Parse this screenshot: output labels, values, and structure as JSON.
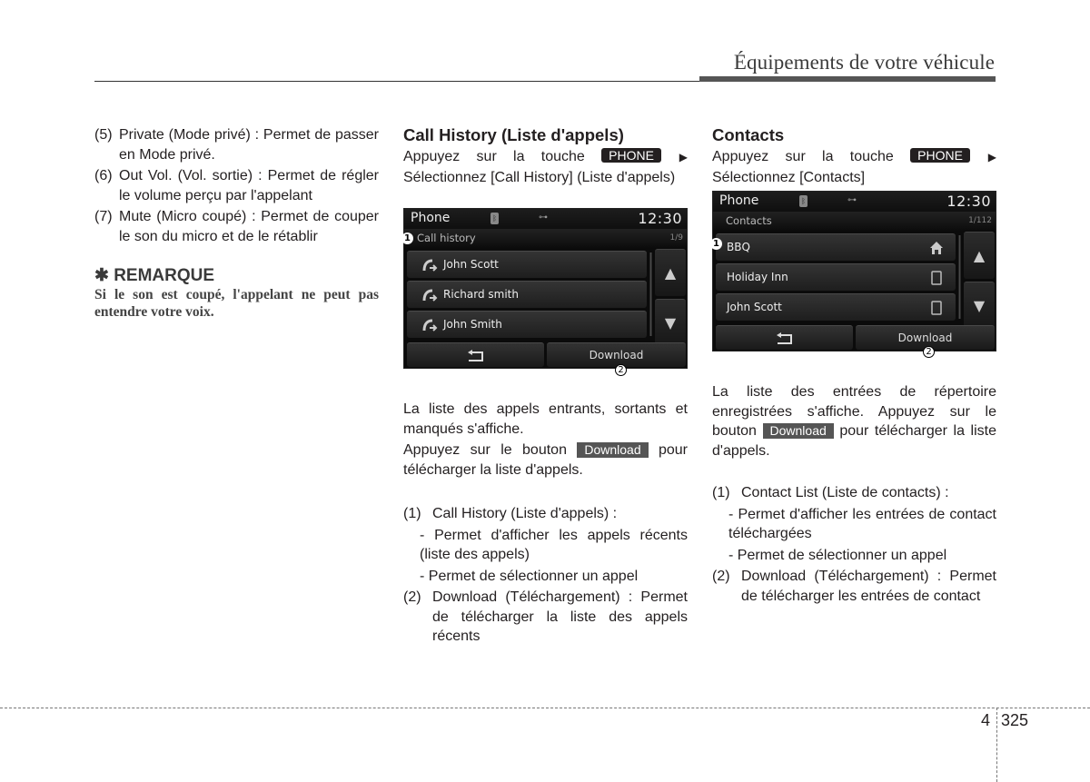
{
  "header": {
    "title": "Équipements de votre véhicule"
  },
  "col1": {
    "items": [
      {
        "num": "(5)",
        "text": "Private (Mode privé) : Permet de passer en Mode privé."
      },
      {
        "num": "(6)",
        "text": "Out Vol. (Vol. sortie) : Permet de régler le volume perçu par l'appelant"
      },
      {
        "num": "(7)",
        "text": "Mute (Micro coupé) : Permet de couper le son du micro et de le rétablir"
      }
    ],
    "note": {
      "symbol": "✱",
      "title": "REMARQUE",
      "body": "Si le son est coupé, l'appelant ne peut pas entendre votre voix."
    }
  },
  "call_history": {
    "title": "Call History (Liste d'appels)",
    "instr_pre": "Appuyez sur la touche",
    "phone_key": "PHONE",
    "instr_post": "Sélectionnez [Call History] (Liste d'appels)",
    "screen": {
      "app": "Phone",
      "time": "12:30",
      "sub_label": "Call history",
      "count": "1/9",
      "rows": [
        "John Scott",
        "Richard smith",
        "John Smith"
      ],
      "download": "Download",
      "callouts": [
        "1",
        "2"
      ]
    },
    "desc1": "La liste des appels entrants, sortants et manqués s'affiche.",
    "desc2_pre": "Appuyez sur le bouton",
    "download_key": "Download",
    "desc2_post": "pour télécharger la liste d'appels.",
    "list": [
      {
        "num": "(1)",
        "text": "Call History (Liste d'appels) :"
      },
      {
        "num": "",
        "text": "- Permet d'afficher les appels récents (liste des appels)"
      },
      {
        "num": "",
        "text": "- Permet de sélectionner un appel"
      },
      {
        "num": "(2)",
        "text": "Download (Téléchargement) : Permet de télécharger la liste des appels récents"
      }
    ]
  },
  "contacts": {
    "title": "Contacts",
    "instr_pre": "Appuyez sur la touche",
    "phone_key": "PHONE",
    "instr_post": "Sélectionnez [Contacts]",
    "screen": {
      "app": "Phone",
      "time": "12:30",
      "sub_label": "Contacts",
      "count": "1/112",
      "rows": [
        {
          "name": "BBQ",
          "icon": "home-icon"
        },
        {
          "name": "Holiday Inn",
          "icon": "mobile-icon"
        },
        {
          "name": "John Scott",
          "icon": "mobile-icon"
        }
      ],
      "download": "Download",
      "callouts": [
        "1",
        "2"
      ]
    },
    "desc_pre": "La liste des entrées de répertoire enregistrées s'affiche. Appuyez sur le bouton",
    "download_key": "Download",
    "desc_post": "pour télécharger la liste d'appels.",
    "list": [
      {
        "num": "(1)",
        "text": "Contact List (Liste de contacts) :"
      },
      {
        "num": "",
        "text": "- Permet d'afficher les entrées de contact téléchargées"
      },
      {
        "num": "",
        "text": "- Permet de sélectionner un appel"
      },
      {
        "num": "(2)",
        "text": "Download (Téléchargement) : Permet de télécharger les entrées de contact"
      }
    ]
  },
  "footer": {
    "chapter": "4",
    "page": "325"
  }
}
